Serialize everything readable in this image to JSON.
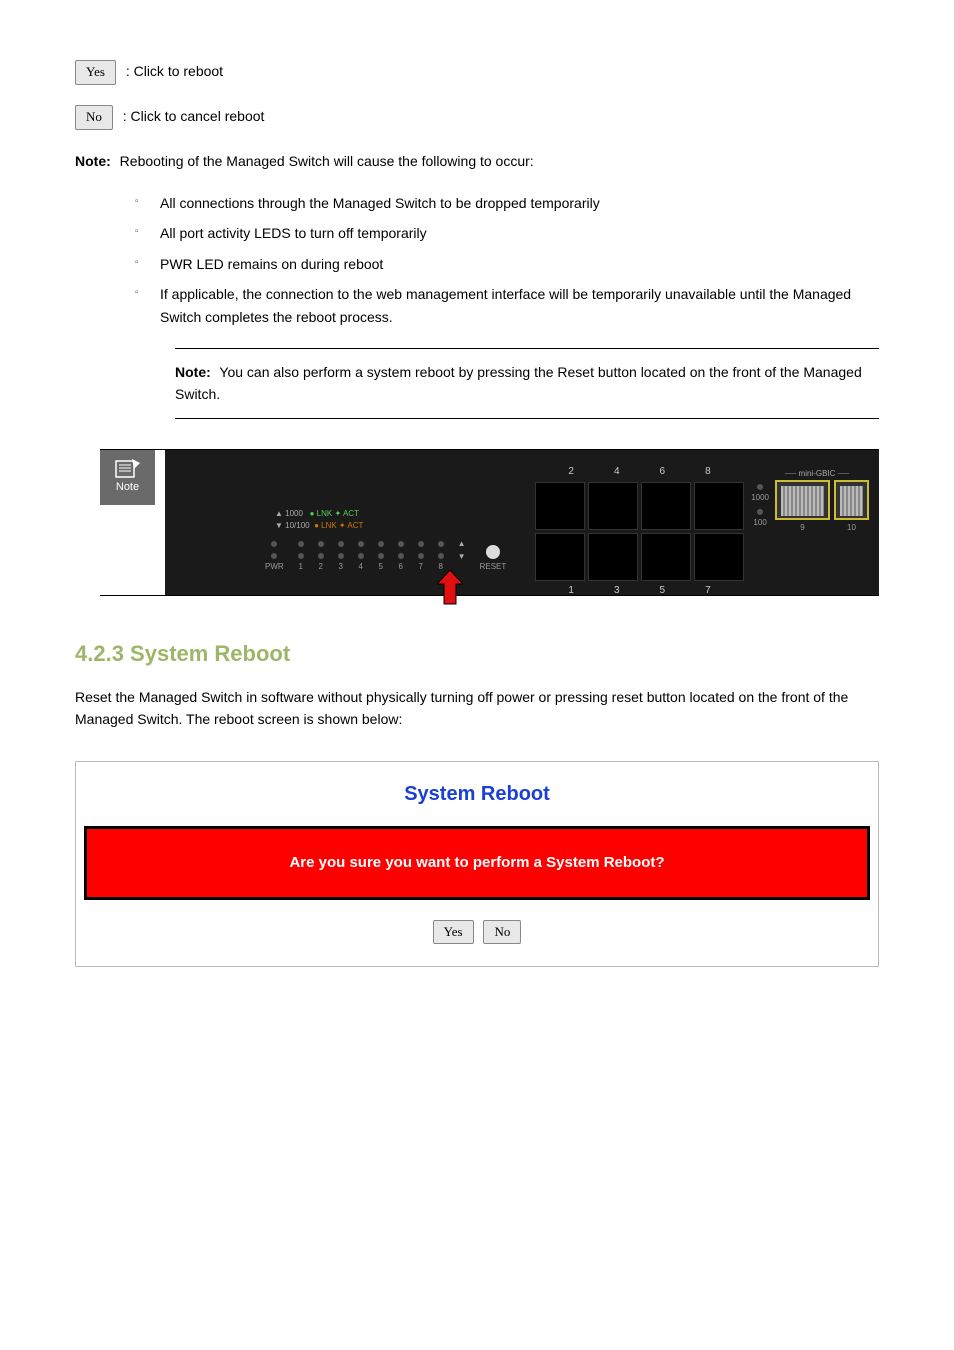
{
  "yes_btn": "Yes",
  "yes_desc": ": Click to reboot",
  "no_btn": "No",
  "no_desc": ": Click to cancel reboot",
  "note1_label": "Note:",
  "note1_text": " Rebooting of the Managed Switch will cause the following to occur:",
  "bullets": [
    "All connections through the Managed Switch to be dropped temporarily",
    "All port activity LEDS to turn off temporarily",
    "PWR LED remains on during reboot",
    "If applicable, the connection to the web management interface will be temporarily unavailable until the Managed Switch completes the reboot process."
  ],
  "note2_label": "Note:",
  "note2_text": " You can also perform a system reboot by pressing the Reset button located on the front of the Managed Switch.",
  "switch_legend": {
    "speed1000": "1000",
    "speed10100": "10/100",
    "lnk": "LNK",
    "act": "ACT",
    "pwr": "PWR",
    "reset": "RESET",
    "mini_gbic": "mini-GBIC",
    "ports_top": [
      "2",
      "4",
      "6",
      "8"
    ],
    "ports_bottom": [
      "1",
      "3",
      "5",
      "7"
    ],
    "port_nums": [
      "1",
      "2",
      "3",
      "4",
      "5",
      "6",
      "7",
      "8"
    ],
    "sfp_ports": [
      "9",
      "10"
    ],
    "speed_1000": "1000",
    "speed_100": "100"
  },
  "heading": "4.2.3 System Reboot",
  "heading_para": "Reset the Managed Switch in software without physically turning off power or pressing reset button located on the front of the Managed Switch. The reboot screen is shown below:",
  "panel": {
    "title": "System Reboot",
    "warning": "Are you sure you want to perform a System Reboot?",
    "yes": "Yes",
    "no": "No"
  }
}
